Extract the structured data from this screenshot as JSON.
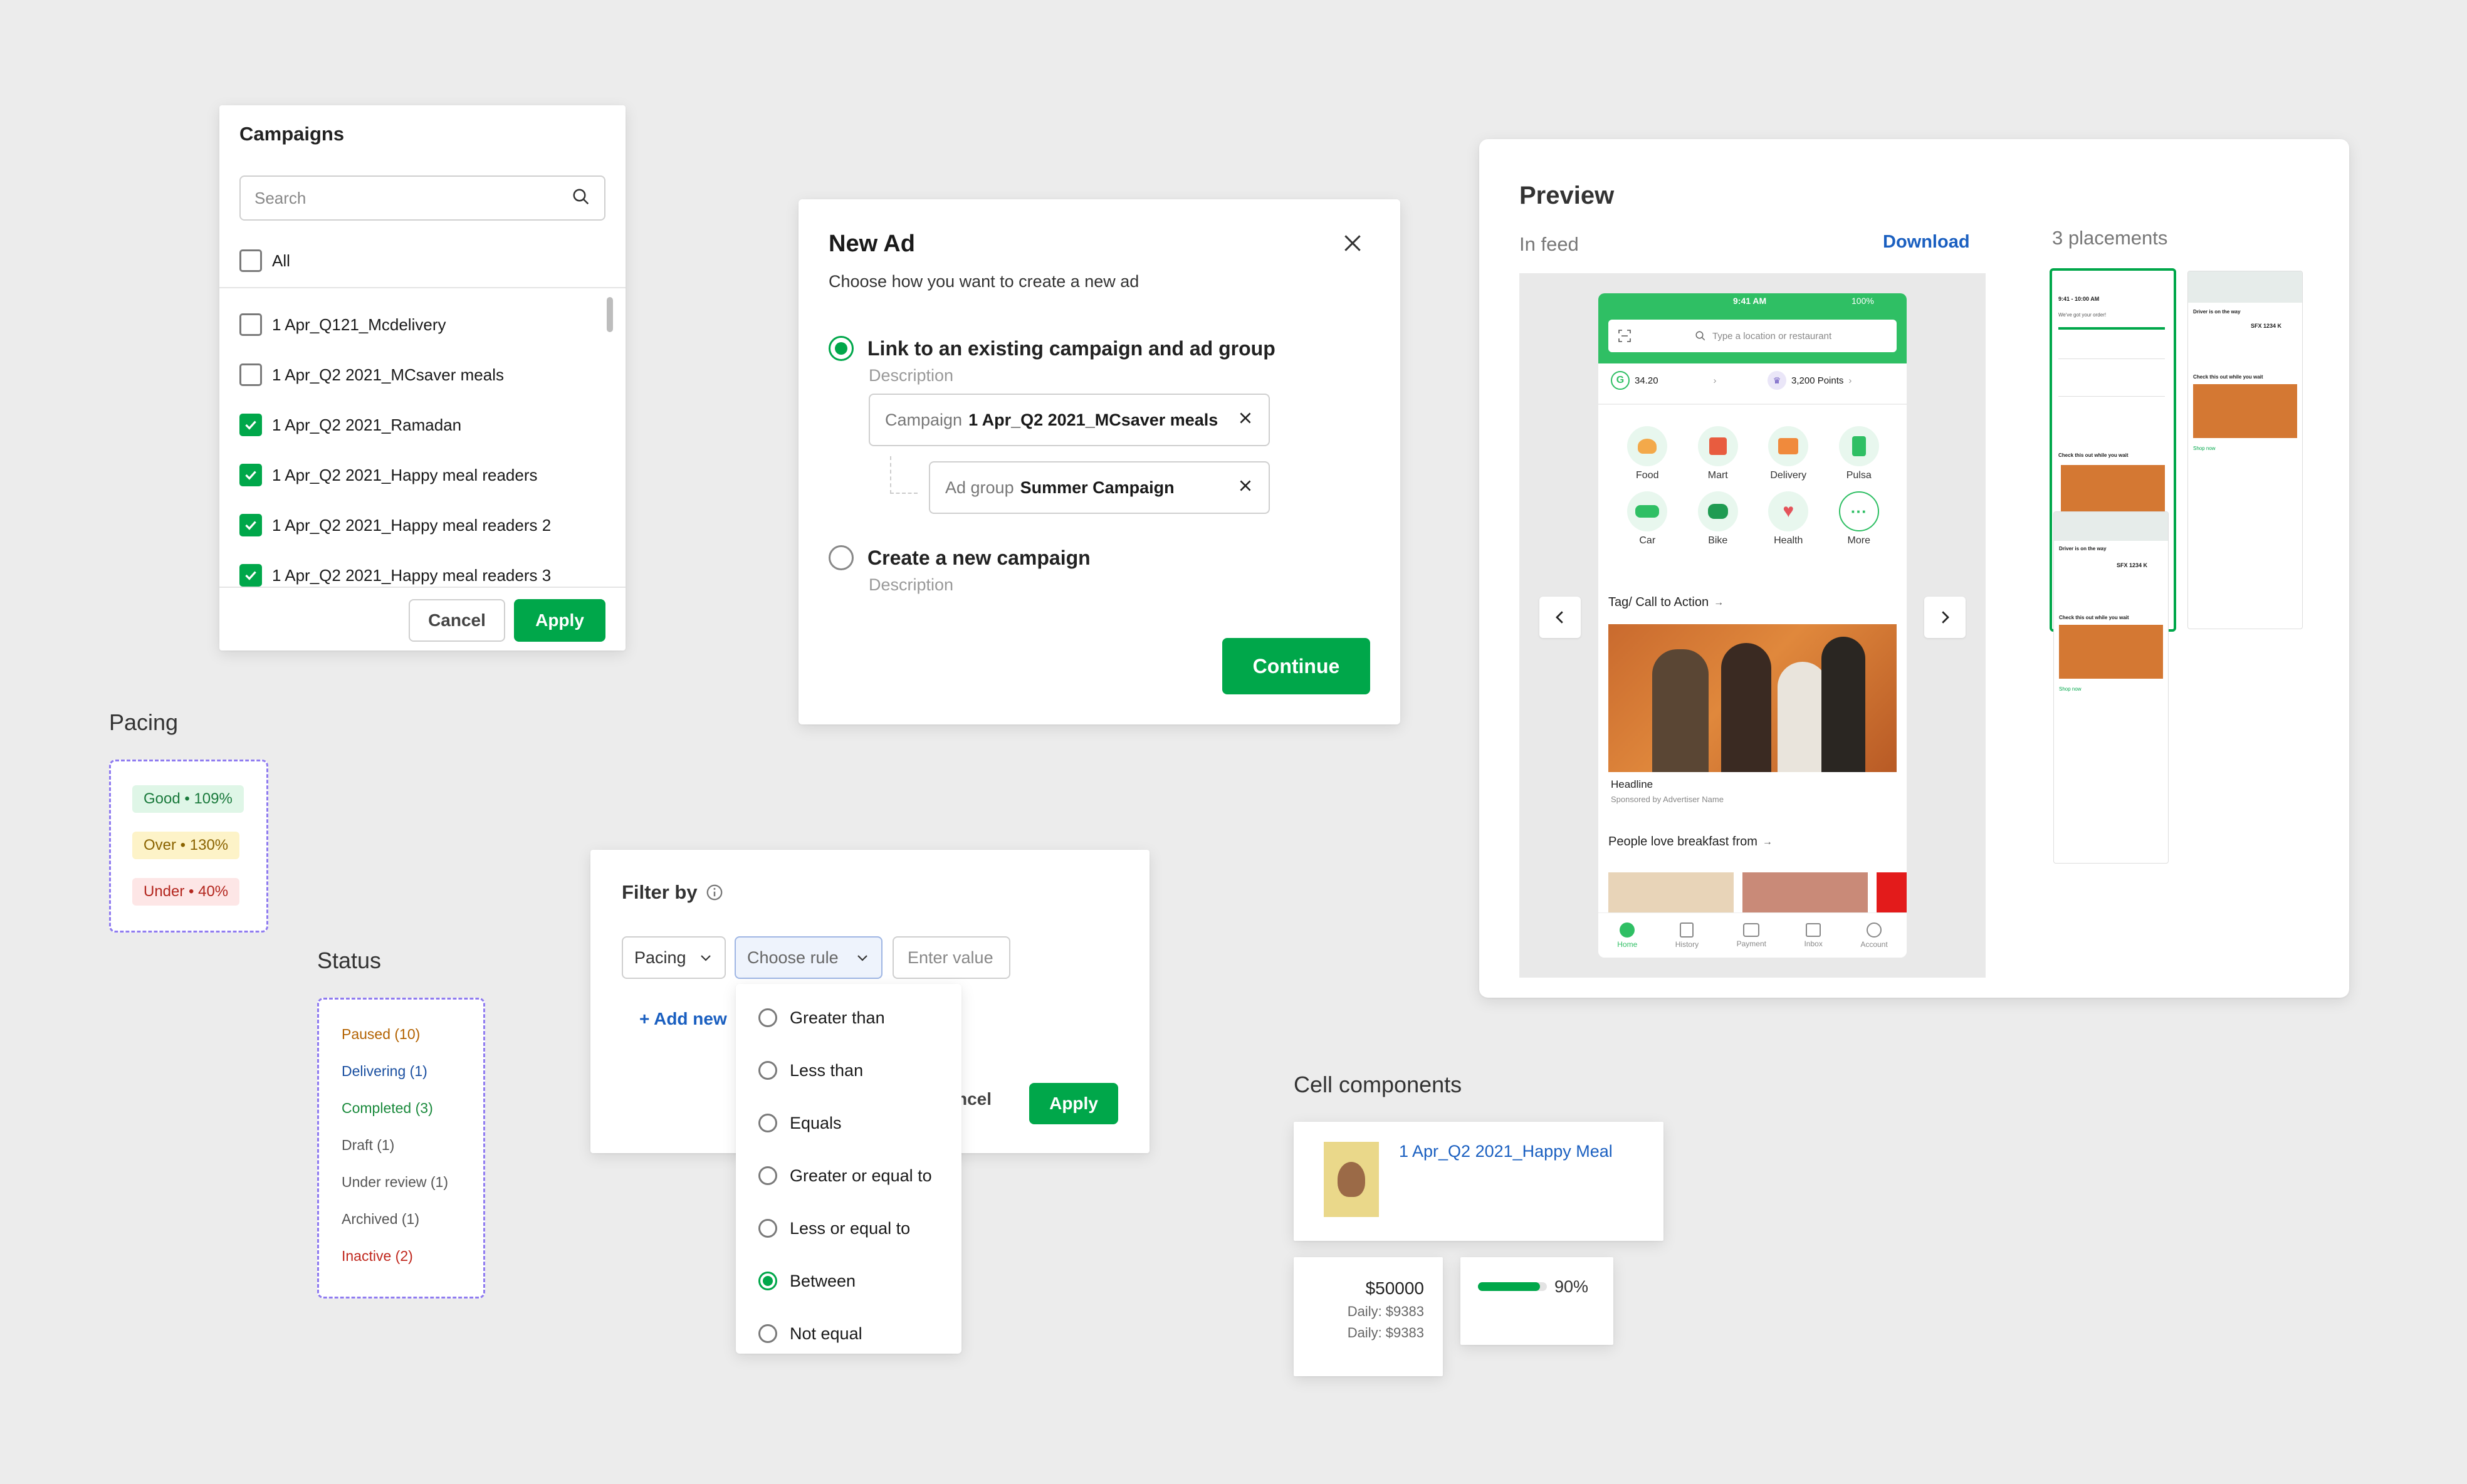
{
  "campaigns": {
    "title": "Campaigns",
    "search_placeholder": "Search",
    "all_label": "All",
    "items": [
      {
        "label": "1 Apr_Q121_Mcdelivery",
        "checked": false
      },
      {
        "label": "1 Apr_Q2 2021_MCsaver meals",
        "checked": false
      },
      {
        "label": "1 Apr_Q2 2021_Ramadan",
        "checked": true
      },
      {
        "label": "1 Apr_Q2 2021_Happy meal readers",
        "checked": true
      },
      {
        "label": "1 Apr_Q2 2021_Happy meal readers 2",
        "checked": true
      },
      {
        "label": "1 Apr_Q2 2021_Happy meal readers 3",
        "checked": true
      }
    ],
    "cancel_label": "Cancel",
    "apply_label": "Apply"
  },
  "new_ad": {
    "title": "New Ad",
    "subtitle": "Choose how you want to create a new ad",
    "option1_label": "Link to an existing campaign and ad group",
    "option1_desc": "Description",
    "campaign_prefix": "Campaign",
    "campaign_value": "1 Apr_Q2 2021_MCsaver meals",
    "adgroup_prefix": "Ad group",
    "adgroup_value": "Summer Campaign",
    "option2_label": "Create a new campaign",
    "option2_desc": "Description",
    "continue_label": "Continue"
  },
  "preview": {
    "title": "Preview",
    "in_feed": "In feed",
    "download": "Download",
    "placements": "3 placements",
    "phone": {
      "time": "9:41 AM",
      "battery": "100%",
      "search_placeholder": "Type a location or restaurant",
      "balance": "34.20",
      "points": "3,200 Points",
      "services": [
        "Food",
        "Mart",
        "Delivery",
        "Pulsa",
        "Car",
        "Bike",
        "Health",
        "More"
      ],
      "tag_cta": "Tag/ Call to Action",
      "headline": "Headline",
      "sponsored": "Sponsored by Advertiser Name",
      "people_love": "People love breakfast from",
      "nav": [
        "Home",
        "History",
        "Payment",
        "Inbox",
        "Account"
      ]
    },
    "thumb_texts": {
      "time": "9:41 - 10:00 AM",
      "question": "We've got your order!",
      "driver_title": "Driver is on the way",
      "plate": "SFX 1234 K",
      "promo": "Check this out while you wait",
      "shop": "Shop now"
    }
  },
  "pacing": {
    "title": "Pacing",
    "items": [
      {
        "label": "Good • 109%",
        "bg": "#dff6e7",
        "color": "#1a7a3c"
      },
      {
        "label": "Over • 130%",
        "bg": "#fdf3c8",
        "color": "#8a6300"
      },
      {
        "label": "Under • 40%",
        "bg": "#fde6e6",
        "color": "#b3261e"
      }
    ]
  },
  "status": {
    "title": "Status",
    "items": [
      {
        "label": "Paused (10)",
        "color": "#b36200"
      },
      {
        "label": "Delivering (1)",
        "color": "#1a4fa0"
      },
      {
        "label": "Completed (3)",
        "color": "#1a8a3c"
      },
      {
        "label": "Draft (1)",
        "color": "#555555"
      },
      {
        "label": "Under review (1)",
        "color": "#555555"
      },
      {
        "label": "Archived (1)",
        "color": "#555555"
      },
      {
        "label": "Inactive (2)",
        "color": "#c0271d"
      }
    ]
  },
  "filter": {
    "title": "Filter by",
    "field": "Pacing",
    "rule_placeholder": "Choose rule",
    "value_placeholder": "Enter value",
    "add_new": "+ Add new",
    "cancel_partial": "ncel",
    "apply_label": "Apply",
    "options": [
      {
        "label": "Greater than",
        "selected": false
      },
      {
        "label": "Less than",
        "selected": false
      },
      {
        "label": "Equals",
        "selected": false
      },
      {
        "label": "Greater or equal to",
        "selected": false
      },
      {
        "label": "Less or equal to",
        "selected": false
      },
      {
        "label": "Between",
        "selected": true
      },
      {
        "label": "Not equal",
        "selected": false
      }
    ]
  },
  "cells": {
    "title": "Cell components",
    "link": "1 Apr_Q2 2021_Happy Meal",
    "budget": "$50000",
    "daily1": "Daily: $9383",
    "daily2": "Daily: $9383",
    "progress_label": "90%",
    "progress_value": 0.9
  },
  "colors": {
    "accent": "#00a74a",
    "link": "#1a5fc0"
  }
}
